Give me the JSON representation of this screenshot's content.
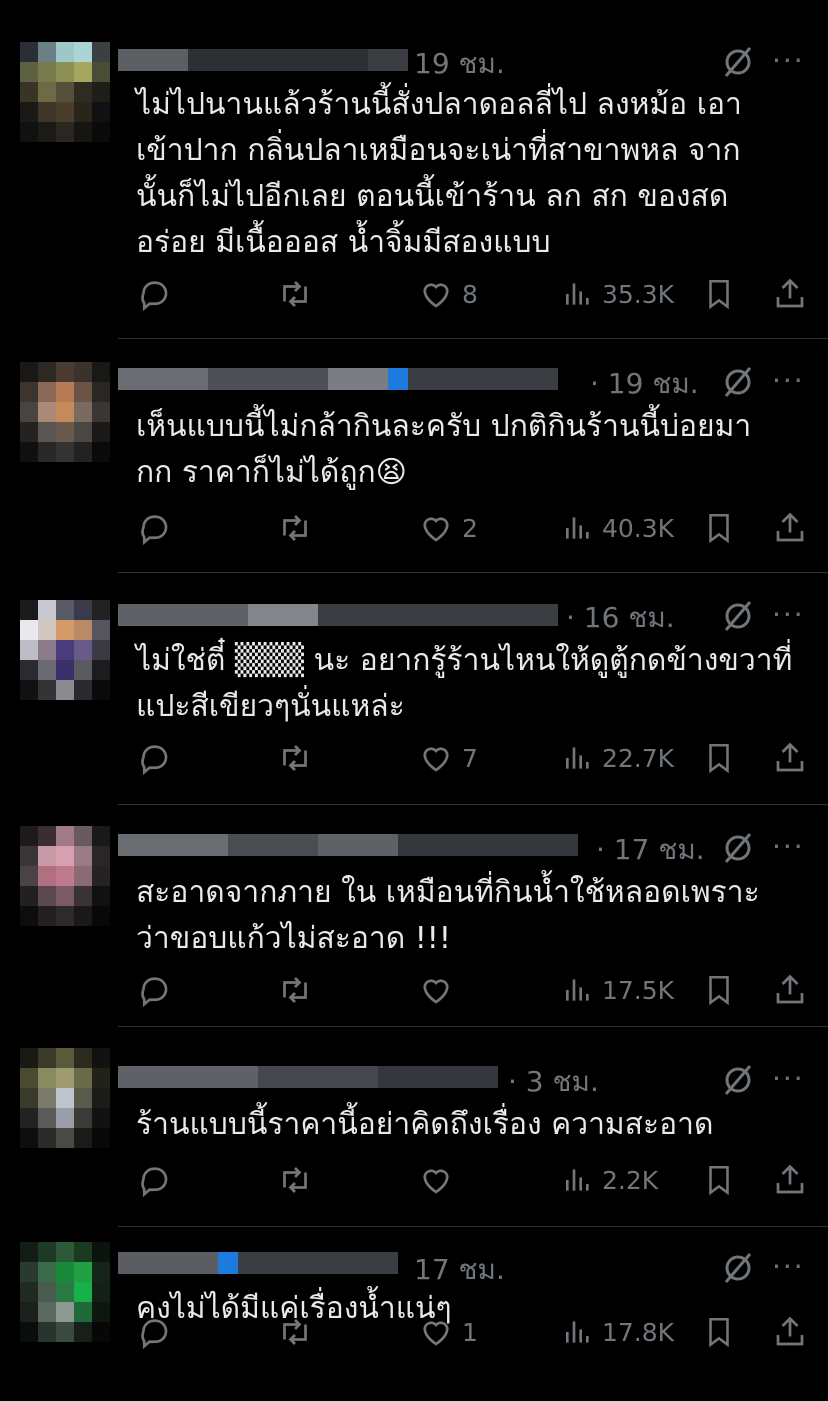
{
  "replies": [
    {
      "time": "19 ชม.",
      "text": "ไม่ไปนานแล้วร้านนี้สั่งปลาดอลลี่ไป ลงหม้อ เอา\nเข้าปาก กลิ่นปลาเหมือนจะเน่าที่สาขาพหล จาก\nนั้นก็ไม่ไปอีกเลย ตอนนี้เข้าร้าน ลก สก ของสด\nอร่อย มีเนื้อออส น้ำจิ้มมีสองแบบ",
      "likes": "8",
      "views": "35.3K"
    },
    {
      "time": "· 19 ชม.",
      "text": "เห็นแบบนี้ไม่กล้ากินละครับ ปกติกินร้านนี้บ่อยมา\nกก ราคาก็ไม่ได้ถูก😫",
      "likes": "2",
      "views": "40.3K"
    },
    {
      "time": "· 16 ชม.",
      "text": "ไม่ใช่ตี๋ ▒▒▒ นะ อยากรู้ร้านไหนให้ดูตู้กดข้างขวาที่\nแปะสีเขียวๆนั่นแหล่ะ",
      "likes": "7",
      "views": "22.7K"
    },
    {
      "time": "· 17 ชม.",
      "text": "สะอาดจากภาย ใน เหมือนที่กินน้ำใช้หลอดเพราะ\nว่าขอบแก้วไม่สะอาด !!!",
      "likes": "",
      "views": "17.5K"
    },
    {
      "time": "· 3 ชม.",
      "text": "ร้านแบบนี้ราคานี้อย่าคิดถึงเรื่อง ความสะอาด",
      "likes": "",
      "views": "2.2K"
    },
    {
      "time": "17 ชม.",
      "text": "คงไม่ได้มีแค่เรื่องน้ำแน่ๆ",
      "likes": "1",
      "views": "17.8K"
    }
  ],
  "more_label": "···",
  "icons": {
    "reply": "reply-icon",
    "retweet": "retweet-icon",
    "like": "heart-icon",
    "views": "views-icon",
    "bookmark": "bookmark-icon",
    "share": "share-icon",
    "grok": "grok-icon"
  },
  "colors": {
    "background": "#000000",
    "text": "#e7e9ea",
    "muted": "#71767b",
    "divider": "#2f3336"
  }
}
